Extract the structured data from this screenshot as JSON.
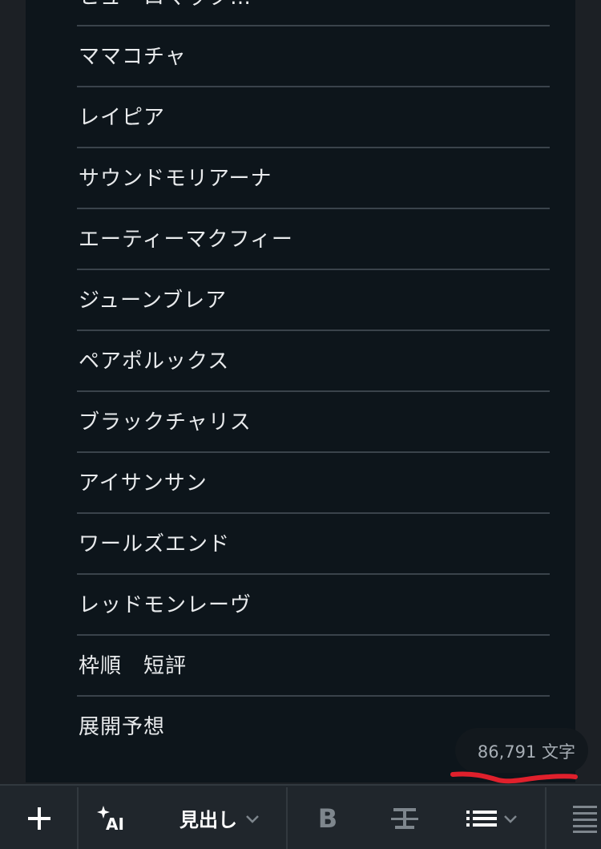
{
  "document": {
    "items": [
      "ヒューロマック…",
      "ママコチャ",
      "レイピア",
      "サウンドモリアーナ",
      "エーティーマクフィー",
      "ジューンブレア",
      "ペアポルックス",
      "ブラックチャリス",
      "アイサンサン",
      "ワールズエンド",
      "レッドモンレーヴ",
      "枠順　短評",
      "展開予想"
    ]
  },
  "status": {
    "char_count": "86,791 文字"
  },
  "toolbar": {
    "heading_label": "見出し",
    "bold_label": "B",
    "icons": [
      "plus-icon",
      "ai-sparkle-icon",
      "chevron-down-icon",
      "strikethrough-icon",
      "bullet-list-icon",
      "align-icon"
    ]
  },
  "colors": {
    "editor_background": "#0d151b",
    "toolbar_background": "#20262c",
    "text": "#e8eaec",
    "divider": "#3a434b",
    "annotation_red": "#e0202c"
  }
}
